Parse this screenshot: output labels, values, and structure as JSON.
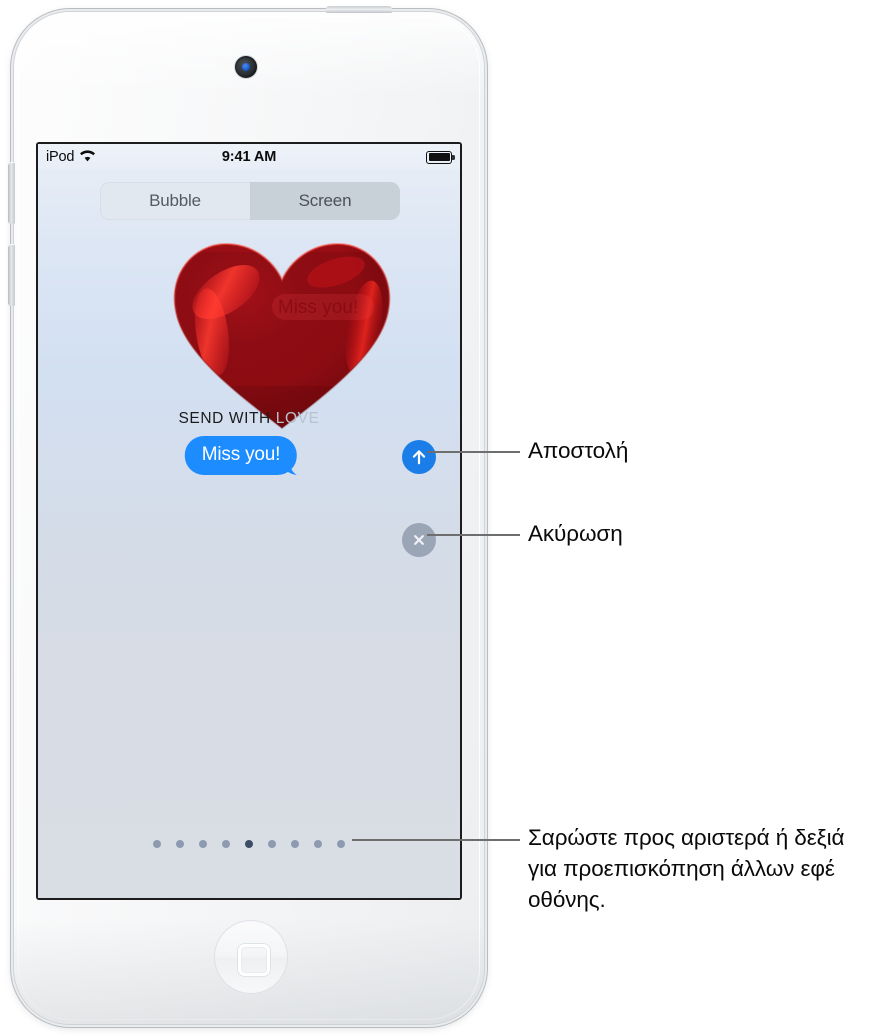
{
  "device": {
    "name": "iPod touch",
    "camera": "front-camera",
    "home_button": "home-button"
  },
  "status_bar": {
    "carrier": "iPod",
    "wifi_icon": "wifi-icon",
    "time": "9:41 AM",
    "battery_icon": "battery-full-icon"
  },
  "segmented_control": {
    "segments": [
      {
        "label": "Bubble",
        "selected": false
      },
      {
        "label": "Screen",
        "selected": true
      }
    ]
  },
  "screen_effect": {
    "effect_icon": "heart-balloon-icon",
    "effect_caption_bold": "SEND WITH ",
    "effect_caption_dim": "LOVE"
  },
  "message": {
    "text": "Miss you!",
    "bubble_color": "#1d8cff",
    "text_color": "#ffffff"
  },
  "actions": {
    "send": {
      "icon": "arrow-up-icon",
      "color": "#1b7de8"
    },
    "cancel": {
      "icon": "close-x-icon",
      "color": "#9aa6b6"
    }
  },
  "page_indicator": {
    "total": 9,
    "active_index": 4
  },
  "callouts": [
    {
      "id": "send",
      "label": "Αποστολή"
    },
    {
      "id": "cancel",
      "label": "Ακύρωση"
    },
    {
      "id": "swipe",
      "label": "Σαρώστε προς αριστερά ή δεξιά για προεπισκόπηση άλλων εφέ οθόνης."
    }
  ]
}
